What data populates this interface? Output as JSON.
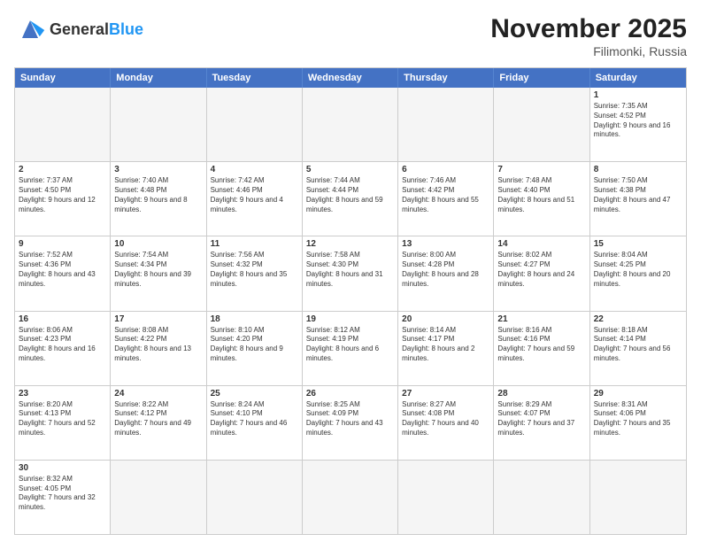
{
  "header": {
    "logo_text_general": "General",
    "logo_text_blue": "Blue",
    "title": "November 2025",
    "subtitle": "Filimonki, Russia"
  },
  "weekdays": [
    "Sunday",
    "Monday",
    "Tuesday",
    "Wednesday",
    "Thursday",
    "Friday",
    "Saturday"
  ],
  "rows": [
    [
      {
        "day": "",
        "info": ""
      },
      {
        "day": "",
        "info": ""
      },
      {
        "day": "",
        "info": ""
      },
      {
        "day": "",
        "info": ""
      },
      {
        "day": "",
        "info": ""
      },
      {
        "day": "",
        "info": ""
      },
      {
        "day": "1",
        "info": "Sunrise: 7:35 AM\nSunset: 4:52 PM\nDaylight: 9 hours and 16 minutes."
      }
    ],
    [
      {
        "day": "2",
        "info": "Sunrise: 7:37 AM\nSunset: 4:50 PM\nDaylight: 9 hours and 12 minutes."
      },
      {
        "day": "3",
        "info": "Sunrise: 7:40 AM\nSunset: 4:48 PM\nDaylight: 9 hours and 8 minutes."
      },
      {
        "day": "4",
        "info": "Sunrise: 7:42 AM\nSunset: 4:46 PM\nDaylight: 9 hours and 4 minutes."
      },
      {
        "day": "5",
        "info": "Sunrise: 7:44 AM\nSunset: 4:44 PM\nDaylight: 8 hours and 59 minutes."
      },
      {
        "day": "6",
        "info": "Sunrise: 7:46 AM\nSunset: 4:42 PM\nDaylight: 8 hours and 55 minutes."
      },
      {
        "day": "7",
        "info": "Sunrise: 7:48 AM\nSunset: 4:40 PM\nDaylight: 8 hours and 51 minutes."
      },
      {
        "day": "8",
        "info": "Sunrise: 7:50 AM\nSunset: 4:38 PM\nDaylight: 8 hours and 47 minutes."
      }
    ],
    [
      {
        "day": "9",
        "info": "Sunrise: 7:52 AM\nSunset: 4:36 PM\nDaylight: 8 hours and 43 minutes."
      },
      {
        "day": "10",
        "info": "Sunrise: 7:54 AM\nSunset: 4:34 PM\nDaylight: 8 hours and 39 minutes."
      },
      {
        "day": "11",
        "info": "Sunrise: 7:56 AM\nSunset: 4:32 PM\nDaylight: 8 hours and 35 minutes."
      },
      {
        "day": "12",
        "info": "Sunrise: 7:58 AM\nSunset: 4:30 PM\nDaylight: 8 hours and 31 minutes."
      },
      {
        "day": "13",
        "info": "Sunrise: 8:00 AM\nSunset: 4:28 PM\nDaylight: 8 hours and 28 minutes."
      },
      {
        "day": "14",
        "info": "Sunrise: 8:02 AM\nSunset: 4:27 PM\nDaylight: 8 hours and 24 minutes."
      },
      {
        "day": "15",
        "info": "Sunrise: 8:04 AM\nSunset: 4:25 PM\nDaylight: 8 hours and 20 minutes."
      }
    ],
    [
      {
        "day": "16",
        "info": "Sunrise: 8:06 AM\nSunset: 4:23 PM\nDaylight: 8 hours and 16 minutes."
      },
      {
        "day": "17",
        "info": "Sunrise: 8:08 AM\nSunset: 4:22 PM\nDaylight: 8 hours and 13 minutes."
      },
      {
        "day": "18",
        "info": "Sunrise: 8:10 AM\nSunset: 4:20 PM\nDaylight: 8 hours and 9 minutes."
      },
      {
        "day": "19",
        "info": "Sunrise: 8:12 AM\nSunset: 4:19 PM\nDaylight: 8 hours and 6 minutes."
      },
      {
        "day": "20",
        "info": "Sunrise: 8:14 AM\nSunset: 4:17 PM\nDaylight: 8 hours and 2 minutes."
      },
      {
        "day": "21",
        "info": "Sunrise: 8:16 AM\nSunset: 4:16 PM\nDaylight: 7 hours and 59 minutes."
      },
      {
        "day": "22",
        "info": "Sunrise: 8:18 AM\nSunset: 4:14 PM\nDaylight: 7 hours and 56 minutes."
      }
    ],
    [
      {
        "day": "23",
        "info": "Sunrise: 8:20 AM\nSunset: 4:13 PM\nDaylight: 7 hours and 52 minutes."
      },
      {
        "day": "24",
        "info": "Sunrise: 8:22 AM\nSunset: 4:12 PM\nDaylight: 7 hours and 49 minutes."
      },
      {
        "day": "25",
        "info": "Sunrise: 8:24 AM\nSunset: 4:10 PM\nDaylight: 7 hours and 46 minutes."
      },
      {
        "day": "26",
        "info": "Sunrise: 8:25 AM\nSunset: 4:09 PM\nDaylight: 7 hours and 43 minutes."
      },
      {
        "day": "27",
        "info": "Sunrise: 8:27 AM\nSunset: 4:08 PM\nDaylight: 7 hours and 40 minutes."
      },
      {
        "day": "28",
        "info": "Sunrise: 8:29 AM\nSunset: 4:07 PM\nDaylight: 7 hours and 37 minutes."
      },
      {
        "day": "29",
        "info": "Sunrise: 8:31 AM\nSunset: 4:06 PM\nDaylight: 7 hours and 35 minutes."
      }
    ],
    [
      {
        "day": "30",
        "info": "Sunrise: 8:32 AM\nSunset: 4:05 PM\nDaylight: 7 hours and 32 minutes."
      },
      {
        "day": "",
        "info": ""
      },
      {
        "day": "",
        "info": ""
      },
      {
        "day": "",
        "info": ""
      },
      {
        "day": "",
        "info": ""
      },
      {
        "day": "",
        "info": ""
      },
      {
        "day": "",
        "info": ""
      }
    ]
  ]
}
